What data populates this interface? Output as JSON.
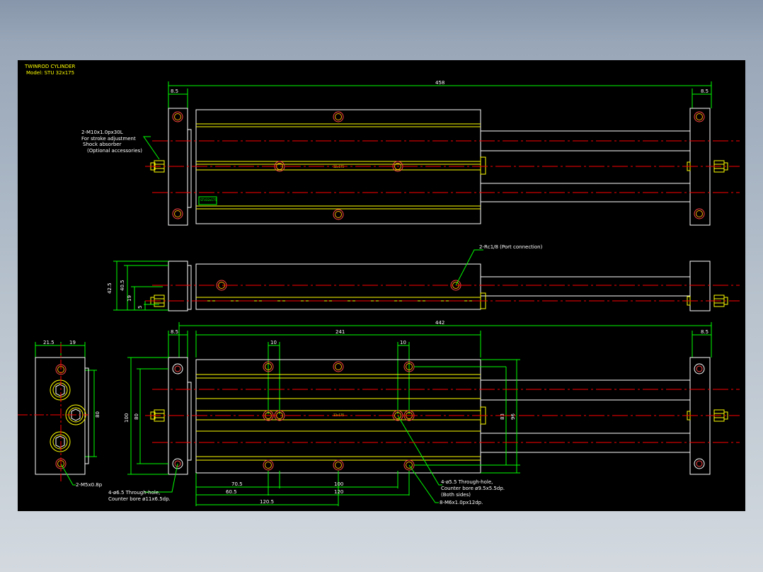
{
  "title_block": {
    "title": "TWINROD CYLINDER",
    "model": "Model: STU 32x175"
  },
  "top_view": {
    "overall_length": "458",
    "end_block_left": "8.5",
    "end_block_right": "8.5",
    "center_mark": "32x175",
    "label_plate": "STU32x175",
    "callout_line1": "2-M10x1.0px30L",
    "callout_line2": "For stroke adjustment",
    "callout_line3": "Shock absorber",
    "callout_line4": "(Optional accessories)"
  },
  "side_view": {
    "port_callout": "2-Rc1/8 (Port connection)",
    "height_total": "42.5",
    "height_body": "40.5",
    "dim_19": "19",
    "dim_5": "5"
  },
  "end_view": {
    "dim_top_left": "21.5",
    "dim_top_right": "19",
    "dim_height": "80",
    "callout": "2-M5x0.8p"
  },
  "bottom_view": {
    "overall_length": "442",
    "end_block_left": "8.5",
    "end_block_right": "8.5",
    "body_length": "241",
    "hole_spacing_left": "10",
    "hole_spacing_right": "10",
    "height_outer": "100",
    "height_inner": "80",
    "height_right_inner": "83",
    "height_right_outer": "96",
    "center_mark": "32x175",
    "dim_70_5": "70.5",
    "dim_100": "100",
    "dim_60_5": "60.5",
    "dim_120": "120",
    "dim_120_5": "120.5",
    "callout_left_1": "4-ø6.5 Through-hole,",
    "callout_left_2": "Counter bore ø11x6.5dp.",
    "callout_right_1": "4-ø5.5 Through-hole,",
    "callout_right_2": "Counter bore ø9.5x5.5dp.",
    "callout_right_3": "(Both sides)",
    "callout_right_4": "8-M6x1.0px12dp."
  },
  "colors": {
    "outline": "#ffffff",
    "edge": "#ffff00",
    "dimension": "#00ff00",
    "centerline": "#ff0000",
    "background": "#000000"
  }
}
